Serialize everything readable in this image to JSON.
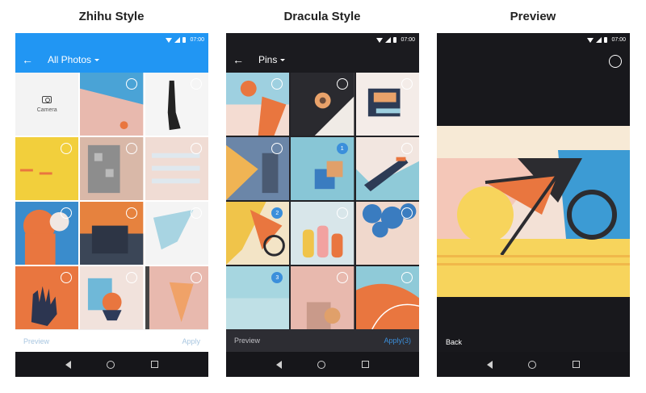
{
  "titles": {
    "zhihu": "Zhihu Style",
    "dracula": "Dracula Style",
    "preview": "Preview"
  },
  "statusbar": {
    "time": "07:00"
  },
  "zhihu": {
    "album": "All Photos",
    "camera_label": "Camera",
    "preview_label": "Preview",
    "apply_label": "Apply",
    "colors": {
      "toolbar": "#2196f3",
      "bg": "#ffffff",
      "bottom_text": "#a8c6e0"
    }
  },
  "dracula": {
    "album": "Pins",
    "preview_label": "Preview",
    "apply_label": "Apply(3)",
    "badges": [
      "1",
      "2",
      "3"
    ],
    "colors": {
      "toolbar": "#1b1b1f",
      "bg": "#222226",
      "bottom_bar": "#2d2d33",
      "accent": "#3b8fdb"
    }
  },
  "preview": {
    "back_label": "Back",
    "colors": {
      "bg": "#18181c"
    }
  },
  "icons": [
    "back-arrow-icon",
    "dropdown-caret-icon",
    "camera-icon",
    "wifi-icon",
    "signal-icon",
    "battery-icon",
    "nav-back-icon",
    "nav-home-icon",
    "nav-recents-icon",
    "select-circle-icon"
  ]
}
